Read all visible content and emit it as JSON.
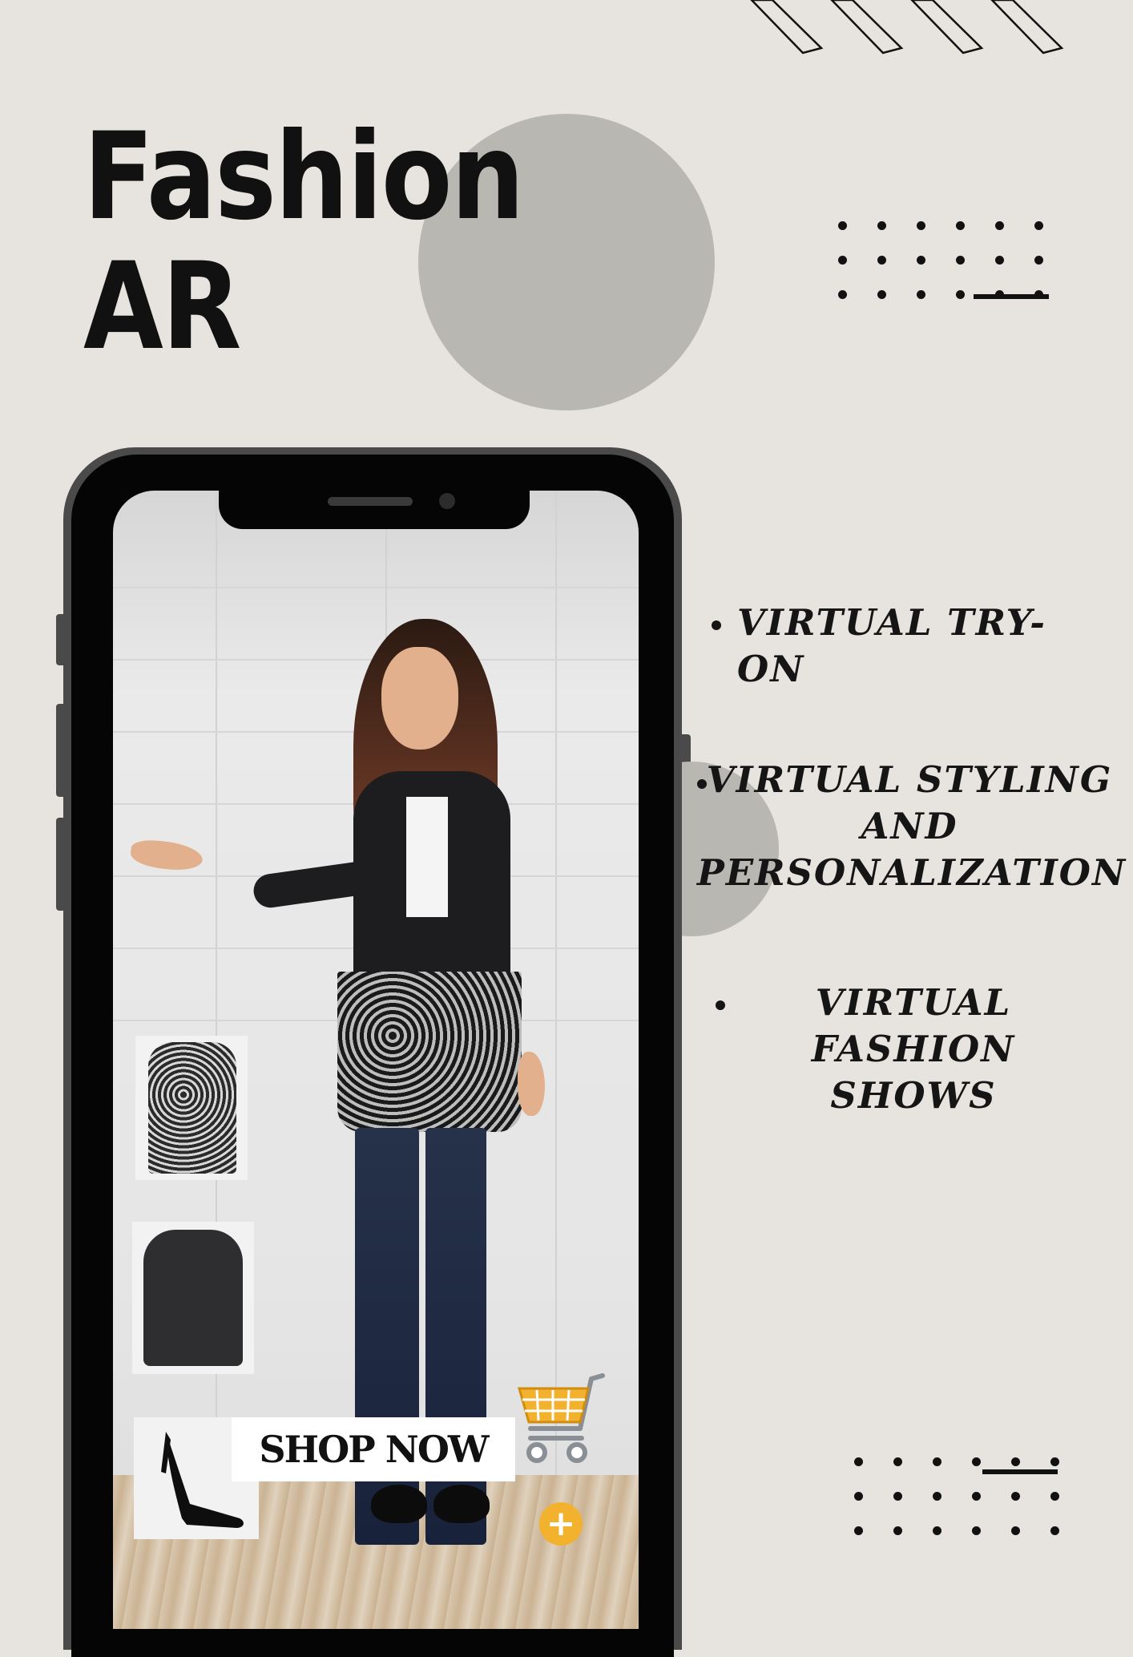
{
  "title": {
    "line1": "Fashion",
    "line2": "AR"
  },
  "features": [
    {
      "label": "VIRTUAL TRY-ON"
    },
    {
      "label": "VIRTUAL STYLING AND PERSONALIZATION"
    },
    {
      "label": "VIRTUAL FASHION SHOWS"
    }
  ],
  "phone": {
    "shop_now_label": "SHOP NOW",
    "plus_label": "+",
    "products": [
      "dress",
      "blazer",
      "heels"
    ]
  },
  "icons": {
    "cart": "shopping-cart-icon",
    "add": "plus-icon"
  },
  "colors": {
    "background": "#e7e3de",
    "deco_circle": "#b9b7b2",
    "cart_accent": "#f2b22e",
    "text": "#111111"
  }
}
